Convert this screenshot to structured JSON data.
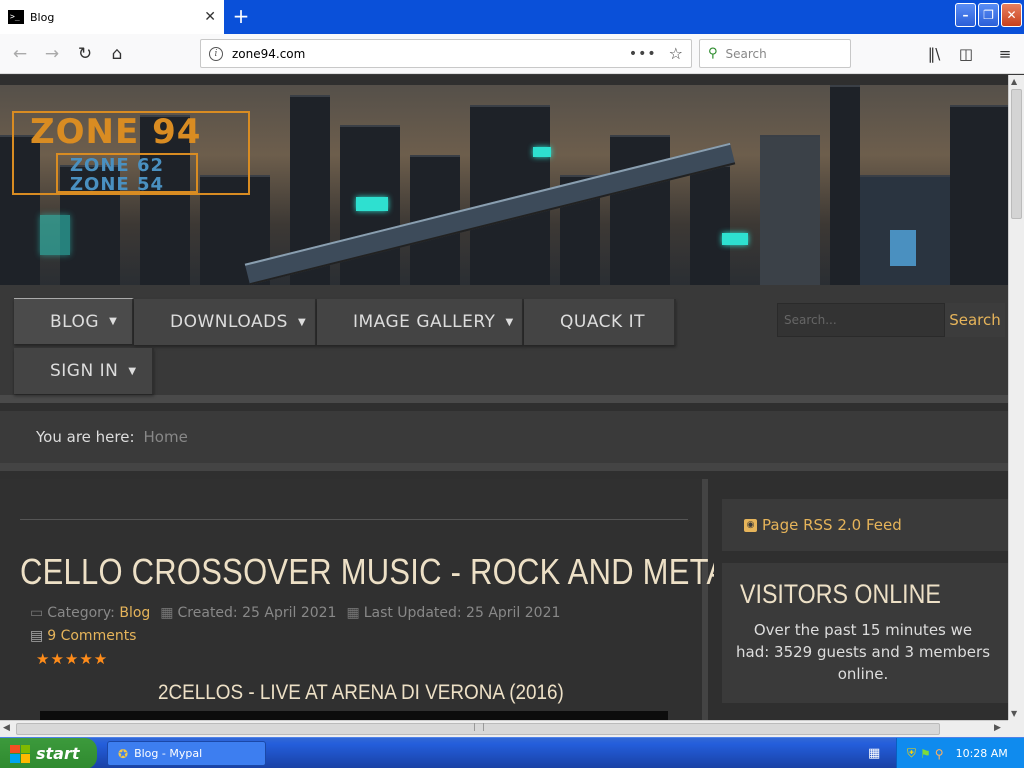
{
  "browser": {
    "tab_title": "Blog",
    "tab_favicon": "terminal-favicon",
    "new_tab": "+",
    "url": "zone94.com",
    "search_placeholder": "Search",
    "window_buttons": {
      "minimize": "–",
      "maximize": "❐",
      "close": "✕"
    }
  },
  "site": {
    "logo": {
      "line1": "ZONE 94",
      "line2": "ZONE 62",
      "line3": "ZONE 54"
    },
    "menu": [
      {
        "label": "BLOG",
        "has_caret": true,
        "active": true
      },
      {
        "label": "DOWNLOADS",
        "has_caret": true
      },
      {
        "label": "IMAGE GALLERY",
        "has_caret": true
      },
      {
        "label": "QUACK IT",
        "has_caret": false
      },
      {
        "label": "SIGN IN",
        "has_caret": true
      }
    ],
    "search_placeholder": "Search...",
    "search_button": "Search",
    "breadcrumb": {
      "label": "You are here:",
      "home": "Home"
    }
  },
  "article": {
    "title": "CELLO CROSSOVER MUSIC - ROCK AND METAL",
    "category_label": "Category:",
    "category": "Blog",
    "created": "Created: 25 April 2021",
    "updated": "Last Updated: 25 April 2021",
    "comments": "9 Comments",
    "rating_stars": 5,
    "stars": "★★★★★",
    "subheading": "2CELLOS - LIVE AT ARENA DI VERONA (2016)"
  },
  "sidebar": {
    "rss": "Page RSS 2.0 Feed",
    "visitors_title": "VISITORS ONLINE",
    "visitors_text": "Over the past 15 minutes we had: 3529 guests and 3 members online."
  },
  "taskbar": {
    "start": "start",
    "window": "Blog - Mypal",
    "clock": "10:28 AM"
  },
  "colors": {
    "accent": "#e6b45a",
    "title": "#ede0c6",
    "star": "#ff8c1a",
    "tabbar": "#0a50d9"
  }
}
